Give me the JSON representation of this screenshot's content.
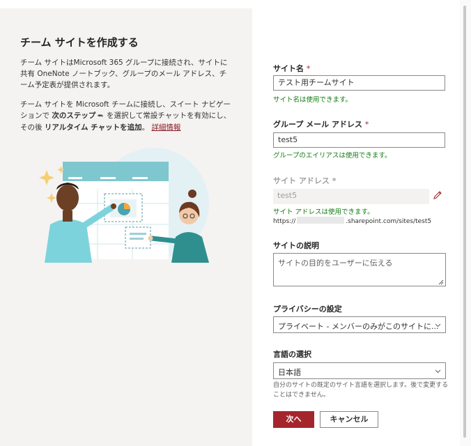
{
  "panel": {
    "title": "チーム サイトを作成する",
    "para1": "チーム サイトはMicrosoft 365 グループに接続され、サイトに共有 OneNote ノートブック、グループのメール アドレス、チーム予定表が提供されます。",
    "para2_a": "チーム サイトを Microsoft チームに接続し、スイート ナビゲーションで ",
    "para2_b": "次のステップ",
    "para2_c": " を選択して常設チャットを有効にし、その後 ",
    "para2_d": "リアルタイム チャットを追加",
    "para2_e": "。",
    "link": "詳細情報"
  },
  "form": {
    "site_name": {
      "label": "サイト名",
      "req": "*",
      "value": "テスト用チームサイト",
      "status": "サイト名は使用できます。"
    },
    "group_email": {
      "label": "グループ メール アドレス",
      "req": "*",
      "value": "test5",
      "status": "グループのエイリアスは使用できます。"
    },
    "site_address": {
      "label": "サイト アドレス",
      "req": "*",
      "value": "test5",
      "status": "サイト アドレスは使用できます。",
      "url_prefix": "https://",
      "url_suffix": ".sharepoint.com/sites/test5"
    },
    "description": {
      "label": "サイトの説明",
      "placeholder": "サイトの目的をユーザーに伝える"
    },
    "privacy": {
      "label": "プライバシーの設定",
      "value": "プライベート - メンバーのみがこのサイトに..."
    },
    "language": {
      "label": "言語の選択",
      "value": "日本語",
      "hint": "自分のサイトの既定のサイト言語を選択します。後で変更することはできません。"
    }
  },
  "buttons": {
    "next": "次へ",
    "cancel": "キャンセル"
  },
  "colors": {
    "accent": "#a4262c",
    "success": "#107c10",
    "panel_bg": "#f5f3f1"
  }
}
